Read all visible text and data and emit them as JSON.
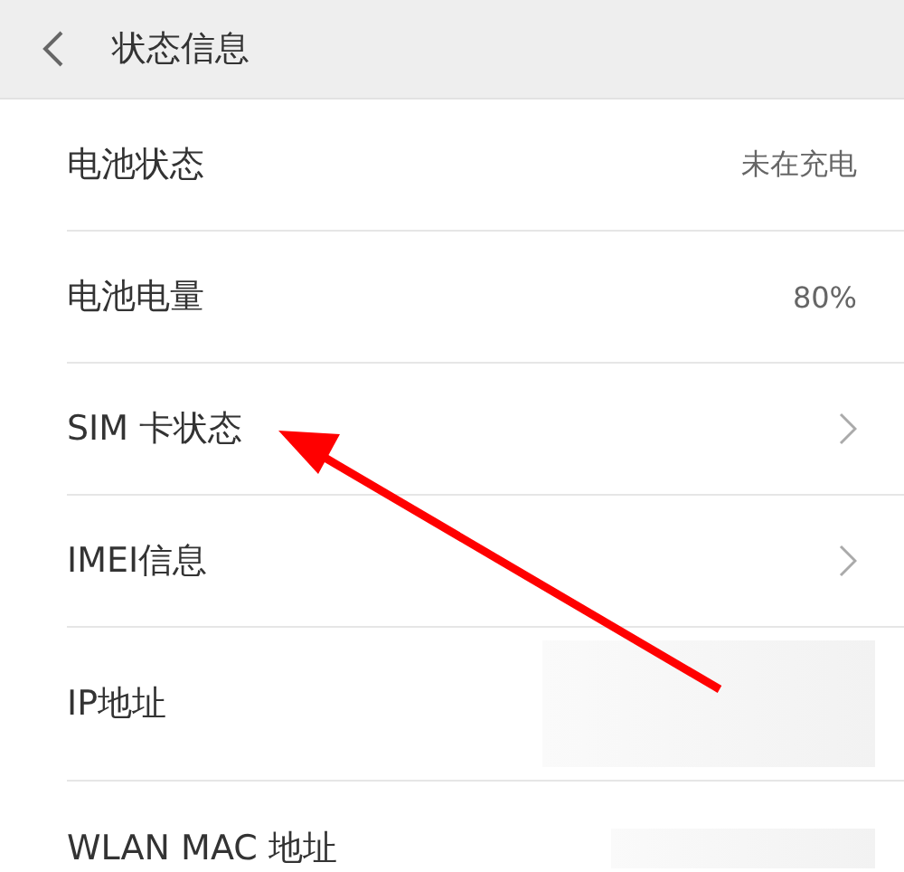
{
  "header": {
    "title": "状态信息"
  },
  "rows": [
    {
      "label": "电池状态",
      "kind": "value",
      "value": "未在充电"
    },
    {
      "label": "电池电量",
      "kind": "value",
      "value": "80%"
    },
    {
      "label": "SIM 卡状态",
      "kind": "link"
    },
    {
      "label": "IMEI信息",
      "kind": "link"
    },
    {
      "label": "IP地址",
      "kind": "hidden"
    },
    {
      "label": "WLAN MAC 地址",
      "kind": "hidden"
    }
  ]
}
